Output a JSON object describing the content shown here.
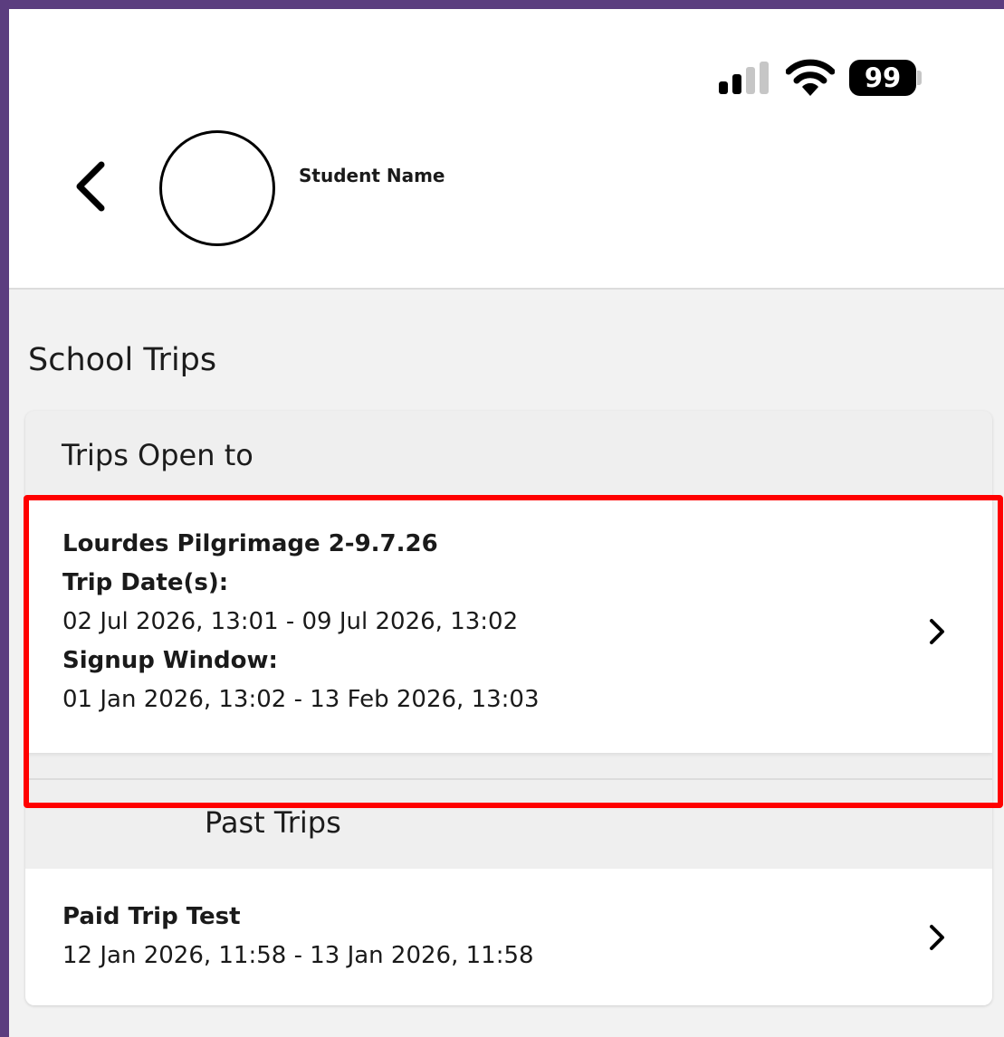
{
  "status_bar": {
    "battery": "99"
  },
  "header": {
    "student_name": "Student Name"
  },
  "page": {
    "section_title": "School Trips"
  },
  "open_trips": {
    "heading": "Trips Open to",
    "items": [
      {
        "title": "Lourdes Pilgrimage 2-9.7.26",
        "dates_label": "Trip Date(s):",
        "dates": "02 Jul 2026, 13:01 - 09 Jul 2026, 13:02",
        "signup_label": "Signup Window:",
        "signup": "01 Jan 2026, 13:02 - 13 Feb 2026, 13:03"
      }
    ]
  },
  "past_trips": {
    "heading": "Past Trips",
    "items": [
      {
        "title": "Paid Trip Test",
        "dates": "12 Jan 2026, 11:58 - 13 Jan 2026, 11:58"
      }
    ]
  },
  "colors": {
    "outer_border": "#5b3d7f",
    "highlight": "#ff0000",
    "background": "#f2f2f2"
  },
  "icons": [
    "signal-icon",
    "wifi-icon",
    "battery-icon",
    "back-chevron-icon",
    "avatar-circle",
    "chevron-right-icon"
  ]
}
